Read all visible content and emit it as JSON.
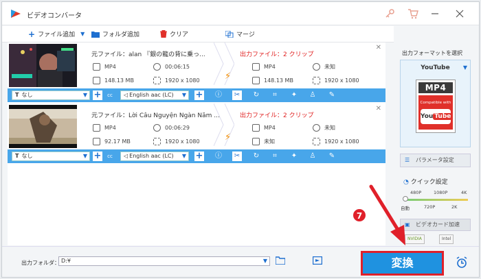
{
  "app": {
    "title": "ビデオコンバータ"
  },
  "toolbar": {
    "add_file": "ファイル追加",
    "add_folder": "フォルダ追加",
    "clear": "クリア",
    "merge": "マージ"
  },
  "items": [
    {
      "source_label": "元ファイル：",
      "source_name": "alan 『銀の龍の背に乗っ...",
      "format": "MP4",
      "duration": "00:06:15",
      "size": "148.13 MB",
      "resolution": "1920 x 1080",
      "output_label": "出力ファイル：2 クリップ",
      "out_format": "MP4",
      "out_duration": "未知",
      "out_size": "148.13 MB",
      "out_resolution": "1920 x 1080",
      "subtitle": "なし",
      "audio": "English aac (LC)"
    },
    {
      "source_label": "元ファイル：",
      "source_name": "Lời Câu Nguyện Ngàn Năm ...",
      "format": "MP4",
      "duration": "00:06:29",
      "size": "92.17 MB",
      "resolution": "1920 x 1080",
      "output_label": "出力ファイル：2 クリップ",
      "out_format": "MP4",
      "out_duration": "未知",
      "out_size": "未知",
      "out_resolution": "1920 x 1080",
      "subtitle": "なし",
      "audio": "English aac (LC)"
    }
  ],
  "right_panel": {
    "title": "出力フォーマットを選択",
    "format_name": "YouTube",
    "card_mp4": "MP4",
    "card_compat": "Compatible with",
    "card_you": "You",
    "card_tube": "Tube",
    "param_button": "パラメータ設定",
    "quick_label": "クイック設定",
    "slider_top": [
      "480P",
      "1080P",
      "4K"
    ],
    "slider_bottom": [
      "自動",
      "720P",
      "2K"
    ],
    "gpu_label": "ビデオカード加速",
    "chip_nvidia": "NVIDIA",
    "chip_intel": "Intel"
  },
  "bottom": {
    "output_folder_label": "出力フォルダ：",
    "output_folder_value": "D:¥",
    "convert_label": "変換"
  },
  "annotation": {
    "step_number": "7"
  },
  "colors": {
    "accent": "#48a6ea",
    "convert": "#1f92e0",
    "highlight": "#e0202a"
  }
}
